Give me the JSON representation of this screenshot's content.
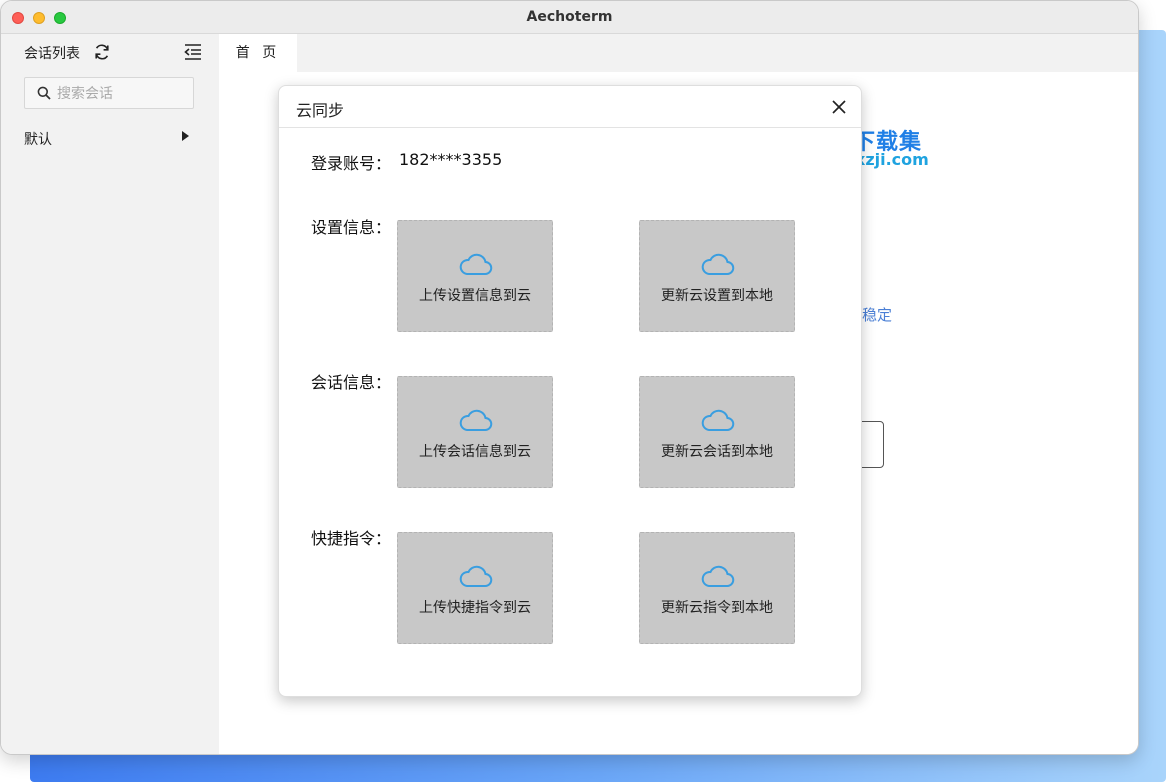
{
  "window": {
    "title": "Aechoterm"
  },
  "sidebar": {
    "title": "会话列表",
    "search_placeholder": "搜索会话",
    "group_label": "默认"
  },
  "tabs": [
    {
      "label": "首 页"
    }
  ],
  "main": {
    "partial_text": "稳定"
  },
  "watermark": {
    "cn": "下载集",
    "en": "xzji.com"
  },
  "dialog": {
    "title": "云同步",
    "account_label": "登录账号：",
    "account_value": "182****3355",
    "sections": [
      {
        "label": "设置信息：",
        "upload": "上传设置信息到云",
        "download": "更新云设置到本地"
      },
      {
        "label": "会话信息：",
        "upload": "上传会话信息到云",
        "download": "更新云会话到本地"
      },
      {
        "label": "快捷指令：",
        "upload": "上传快捷指令到云",
        "download": "更新云指令到本地"
      }
    ]
  },
  "colors": {
    "accent": "#3a9ee0",
    "card_bg": "#c8c8c8",
    "link": "#4a7fd6"
  }
}
